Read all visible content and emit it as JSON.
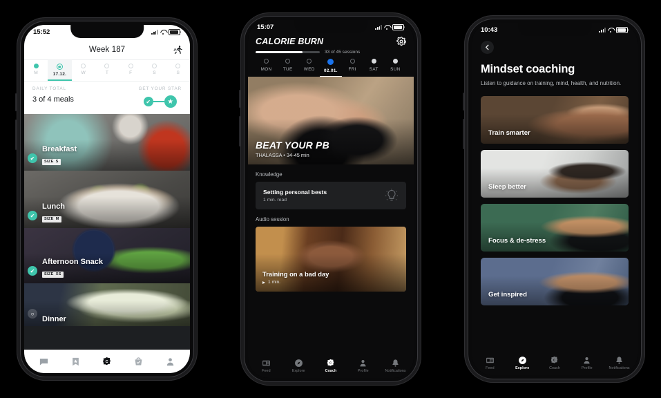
{
  "phone1": {
    "status": {
      "time": "15:52",
      "signal_icon": "cellular-bars-icon",
      "wifi_icon": "wifi-icon",
      "battery_icon": "battery-icon"
    },
    "header": {
      "title": "Week 187",
      "action_icon": "runner-icon"
    },
    "days": [
      {
        "label": "M",
        "state": "done",
        "selected": false
      },
      {
        "label": "17.12.",
        "state": "today",
        "selected": true
      },
      {
        "label": "W",
        "state": "empty",
        "selected": false
      },
      {
        "label": "T",
        "state": "empty",
        "selected": false
      },
      {
        "label": "F",
        "state": "empty",
        "selected": false
      },
      {
        "label": "S",
        "state": "empty",
        "selected": false
      },
      {
        "label": "S",
        "state": "empty",
        "selected": false
      }
    ],
    "summary": {
      "total_caption": "DAILY TOTAL",
      "total_value": "3 of 4 meals",
      "star_caption": "GET YOUR STAR",
      "check_icon": "check-icon",
      "star_icon": "star-icon"
    },
    "meals": [
      {
        "name": "Breakfast",
        "size_label": "SIZE",
        "size_value": "S",
        "checked": true,
        "check_icon": "check-icon"
      },
      {
        "name": "Lunch",
        "size_label": "SIZE",
        "size_value": "M",
        "checked": true,
        "check_icon": "check-icon"
      },
      {
        "name": "Afternoon Snack",
        "size_label": "SIZE",
        "size_value": "XS",
        "checked": true,
        "check_icon": "check-icon"
      },
      {
        "name": "Dinner",
        "size_label": "",
        "size_value": "",
        "checked": false,
        "check_icon": "check-icon"
      }
    ],
    "tabs": [
      {
        "icon": "chat-bubble-icon",
        "active": false
      },
      {
        "icon": "book-star-icon",
        "active": false
      },
      {
        "icon": "coach-c-logo-icon",
        "active": true
      },
      {
        "icon": "basket-check-icon",
        "active": false
      },
      {
        "icon": "person-icon",
        "active": false
      }
    ]
  },
  "phone2": {
    "status": {
      "time": "15:07",
      "signal_icon": "cellular-bars-icon",
      "wifi_icon": "wifi-icon",
      "battery_icon": "battery-icon"
    },
    "header": {
      "title": "CALORIE BURN",
      "settings_icon": "gear-icon"
    },
    "progress": {
      "label": "33 of 45 sessions",
      "percent": 73
    },
    "days": [
      {
        "label": "MON",
        "state": "empty",
        "selected": false
      },
      {
        "label": "TUE",
        "state": "empty",
        "selected": false
      },
      {
        "label": "WED",
        "state": "empty",
        "selected": false
      },
      {
        "label": "02.01.",
        "state": "today",
        "selected": true
      },
      {
        "label": "FRI",
        "state": "empty",
        "selected": false
      },
      {
        "label": "SAT",
        "state": "done",
        "selected": false
      },
      {
        "label": "SUN",
        "state": "done",
        "selected": false
      }
    ],
    "hero": {
      "title": "BEAT YOUR PB",
      "subtitle": "THALASSA  •  34-45 min"
    },
    "knowledge": {
      "section_label": "Knowledge",
      "title": "Setting personal bests",
      "meta": "1 min. read",
      "icon": "lightbulb-icon"
    },
    "audio": {
      "section_label": "Audio session",
      "title": "Training on a bad day",
      "duration": "1 min.",
      "play_icon": "play-icon"
    },
    "tabs": [
      {
        "label": "Feed",
        "icon": "feed-icon",
        "active": false
      },
      {
        "label": "Explore",
        "icon": "compass-icon",
        "active": false
      },
      {
        "label": "Coach",
        "icon": "coach-c-logo-icon",
        "active": true
      },
      {
        "label": "Profile",
        "icon": "person-icon",
        "active": false
      },
      {
        "label": "Notifications",
        "icon": "bell-icon",
        "active": false
      }
    ]
  },
  "phone3": {
    "status": {
      "time": "10:43",
      "signal_icon": "cellular-bars-icon",
      "wifi_icon": "wifi-icon",
      "battery_icon": "battery-icon"
    },
    "header": {
      "back_icon": "chevron-left-icon",
      "title": "Mindset coaching",
      "subtitle": "Listen to guidance on training, mind, health, and nutrition."
    },
    "tiles": [
      {
        "label": "Train smarter",
        "tint": "#6a5442"
      },
      {
        "label": "Sleep better",
        "tint": "#c9cacb"
      },
      {
        "label": "Focus & de-stress",
        "tint": "#4a7460"
      },
      {
        "label": "Get inspired",
        "tint": "#68799a"
      }
    ],
    "tabs": [
      {
        "label": "Feed",
        "icon": "feed-icon",
        "active": false
      },
      {
        "label": "Explore",
        "icon": "compass-icon",
        "active": true
      },
      {
        "label": "Coach",
        "icon": "coach-c-logo-icon",
        "active": false
      },
      {
        "label": "Profile",
        "icon": "person-icon",
        "active": false
      },
      {
        "label": "Notifications",
        "icon": "bell-icon",
        "active": false
      }
    ]
  },
  "theme": {
    "accent_teal": "#3fc5ac",
    "accent_blue": "#1a73ec",
    "dark_bg": "#0b0b0c",
    "card_bg": "#1f2022"
  }
}
